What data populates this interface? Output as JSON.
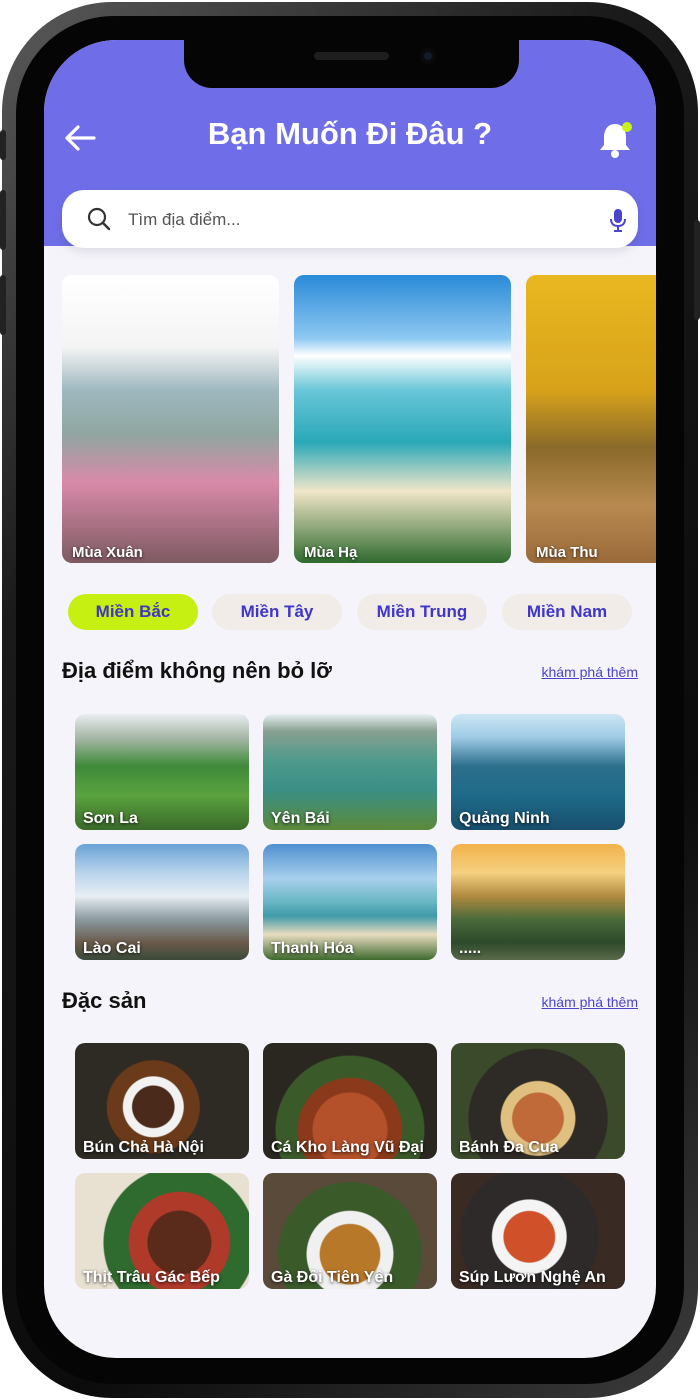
{
  "header": {
    "title": "Bạn Muốn Đi Đâu ?",
    "back_icon": "arrow-left-icon",
    "notification_icon": "bell-icon",
    "notification_dot_color": "#c9f21b",
    "background_color": "#6f6ee8"
  },
  "search": {
    "placeholder": "Tìm địa điểm...",
    "search_icon": "search-icon",
    "mic_icon": "microphone-icon"
  },
  "seasons": [
    {
      "label": "Mùa Xuân"
    },
    {
      "label": "Mùa Hạ"
    },
    {
      "label": "Mùa Thu"
    }
  ],
  "regions": [
    {
      "label": "Miền Bắc",
      "active": true
    },
    {
      "label": "Miền Tây",
      "active": false
    },
    {
      "label": "Miền Trung",
      "active": false
    },
    {
      "label": "Miền Nam",
      "active": false
    }
  ],
  "places_section": {
    "title": "Địa điểm không nên bỏ lỡ",
    "more": "khám phá thêm",
    "items": [
      {
        "label": "Sơn La"
      },
      {
        "label": "Yên Bái"
      },
      {
        "label": "Quảng Ninh"
      },
      {
        "label": "Lào Cai"
      },
      {
        "label": "Thanh Hóa"
      },
      {
        "label": "....."
      }
    ]
  },
  "food_section": {
    "title": "Đặc sản",
    "more": "khám phá thêm",
    "items": [
      {
        "label": "Bún Chả Hà Nội"
      },
      {
        "label": "Cá Kho Làng Vũ Đại"
      },
      {
        "label": "Bánh Đa Cua"
      },
      {
        "label": "Thịt Trâu Gác Bếp"
      },
      {
        "label": "Gà Đồi Tiên Yên"
      },
      {
        "label": "Súp Lươn Nghệ An"
      }
    ]
  },
  "colors": {
    "accent": "#6f6ee8",
    "chip_active": "#c6ef12",
    "chip_inactive": "#f1ece8",
    "chip_text": "#3f36c9",
    "link": "#4a44cf"
  }
}
